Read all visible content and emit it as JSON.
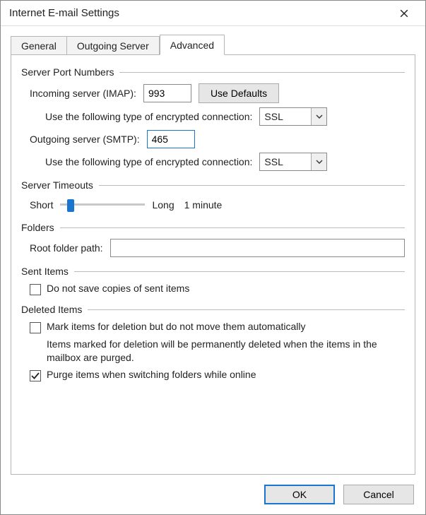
{
  "window": {
    "title": "Internet E-mail Settings"
  },
  "tabs": {
    "general": "General",
    "outgoing": "Outgoing Server",
    "advanced": "Advanced"
  },
  "portGroup": {
    "title": "Server Port Numbers",
    "incomingLabel": "Incoming server (IMAP):",
    "incomingValue": "993",
    "useDefaultsLabel": "Use Defaults",
    "encryptPrompt": "Use the following type of encrypted connection:",
    "incomingEncryption": "SSL",
    "outgoingLabel": "Outgoing server (SMTP):",
    "outgoingValue": "465",
    "outgoingEncryption": "SSL"
  },
  "timeouts": {
    "title": "Server Timeouts",
    "short": "Short",
    "long": "Long",
    "value": "1 minute"
  },
  "folders": {
    "title": "Folders",
    "rootLabel": "Root folder path:",
    "rootValue": ""
  },
  "sent": {
    "title": "Sent Items",
    "noSaveLabel": "Do not save copies of sent items",
    "noSaveChecked": false
  },
  "deleted": {
    "title": "Deleted Items",
    "markLabel": "Mark items for deletion but do not move them automatically",
    "markChecked": false,
    "markHelper": "Items marked for deletion will be permanently deleted when the items in the mailbox are purged.",
    "purgeLabel": "Purge items when switching folders while online",
    "purgeChecked": true
  },
  "buttons": {
    "ok": "OK",
    "cancel": "Cancel"
  }
}
